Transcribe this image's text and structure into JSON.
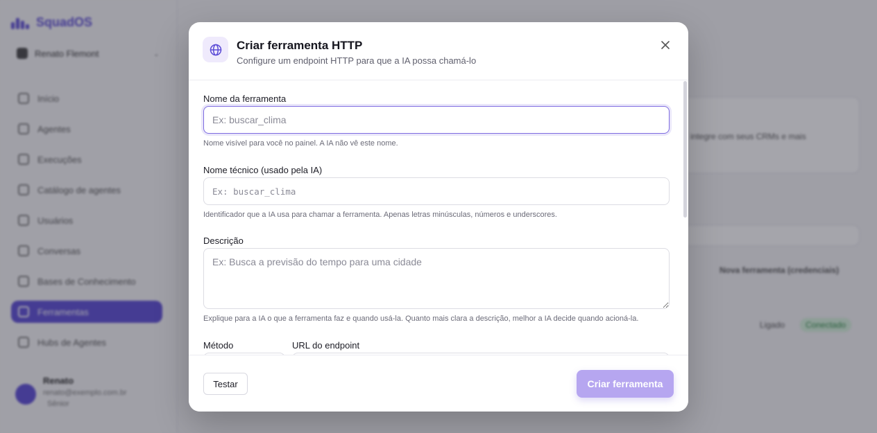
{
  "app": {
    "logo_text": "SquadOS",
    "workspace": "Renato Flemont",
    "nav": [
      {
        "label": "Início"
      },
      {
        "label": "Agentes"
      },
      {
        "label": "Execuções"
      },
      {
        "label": "Catálogo de agentes"
      },
      {
        "label": "Usuários"
      },
      {
        "label": "Conversas"
      },
      {
        "label": "Bases de Conhecimento"
      },
      {
        "label": "Ferramentas",
        "active": true
      },
      {
        "label": "Hubs de Agentes"
      }
    ],
    "user": {
      "name": "Renato",
      "email": "renato@exemplo.com.br",
      "plan": "Sênior"
    },
    "background": {
      "hint_text": "integre com seus CRMs e mais",
      "link_text": "Nova ferramenta (credenciais)",
      "row_label": "Ligado",
      "row_badge": "Conectado"
    }
  },
  "modal": {
    "title": "Criar ferramenta HTTP",
    "subtitle": "Configure um endpoint HTTP para que a IA possa chamá-lo",
    "fields": {
      "tool_name": {
        "label": "Nome da ferramenta",
        "placeholder": "Ex: buscar_clima",
        "value": "",
        "help": "Nome visível para você no painel. A IA não vê este nome."
      },
      "technical_name": {
        "label": "Nome técnico (usado pela IA)",
        "placeholder": "Ex: buscar_clima",
        "value": "",
        "help": "Identificador que a IA usa para chamar a ferramenta. Apenas letras minúsculas, números e underscores."
      },
      "description": {
        "label": "Descrição",
        "placeholder": "Ex: Busca a previsão do tempo para uma cidade",
        "value": "",
        "help": "Explique para a IA o que a ferramenta faz e quando usá-la. Quanto mais clara a descrição, melhor a IA decide quando acioná-la."
      },
      "method": {
        "label": "Método"
      },
      "endpoint_url": {
        "label": "URL do endpoint"
      }
    },
    "buttons": {
      "test": "Testar",
      "create": "Criar ferramenta"
    }
  },
  "colors": {
    "accent": "#5b4bd6",
    "accent_disabled": "#b6a6f0",
    "focus_ring": "#7d6be0"
  },
  "icons": {
    "header": "globe-icon",
    "close": "close-icon"
  }
}
